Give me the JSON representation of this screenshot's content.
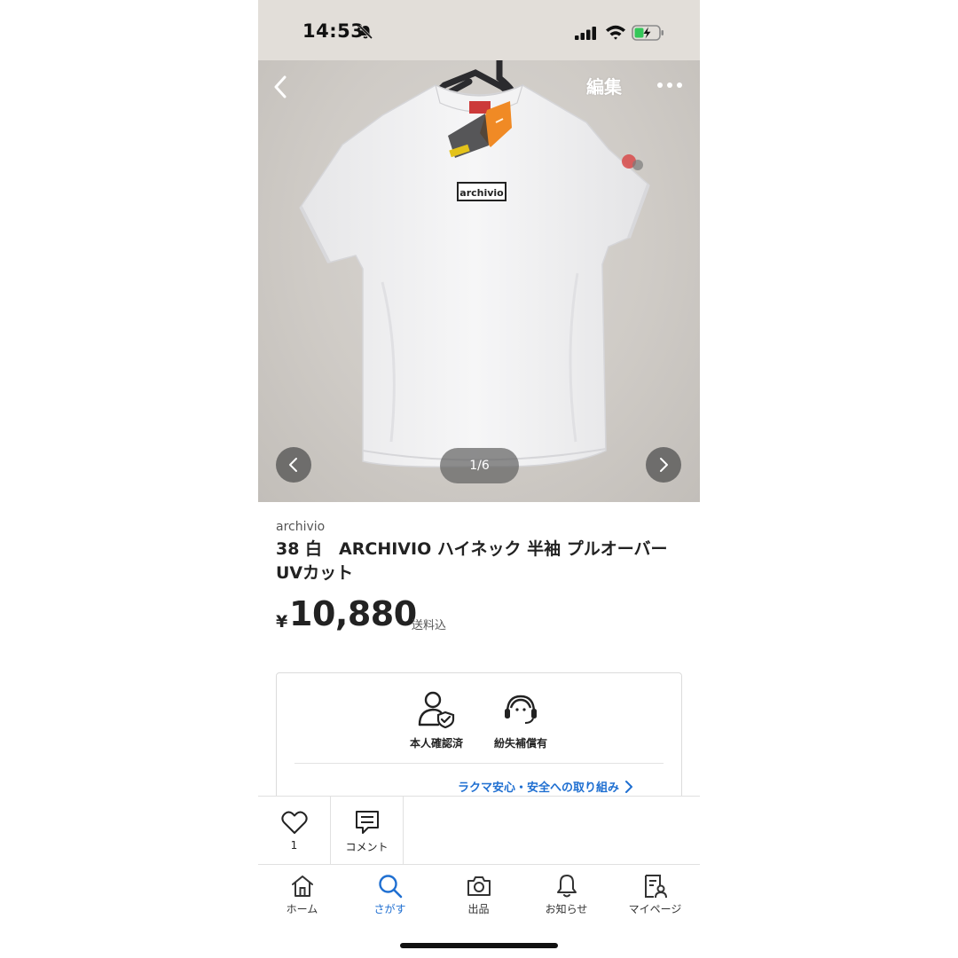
{
  "status_bar": {
    "time": "14:53",
    "icons": [
      "bell-off-icon",
      "signal-icon",
      "wifi-icon",
      "battery-charging-icon"
    ]
  },
  "header": {
    "back_icon": "chevron-left-icon",
    "edit_label": "編集",
    "more_icon": "more-dots-icon"
  },
  "gallery": {
    "current": 1,
    "total": 6,
    "counter_text": "1/6",
    "photo_print_text": "archivio"
  },
  "product": {
    "brand": "archivio",
    "title": "38 白　ARCHIVIO ハイネック 半袖 プルオーバー UVカット",
    "currency_symbol": "¥",
    "price": "10,880",
    "shipping_note": "送料込"
  },
  "trust": {
    "items": [
      {
        "icon": "identity-verified-icon",
        "label": "本人確認済"
      },
      {
        "icon": "support-headset-icon",
        "label": "紛失補償有"
      }
    ],
    "link_label": "ラクマ安心・安全への取り組み"
  },
  "actions": {
    "like": {
      "icon": "heart-icon",
      "count": "1"
    },
    "comment": {
      "icon": "comment-icon",
      "label": "コメント"
    }
  },
  "tabs": [
    {
      "icon": "home-icon",
      "label": "ホーム",
      "active": false
    },
    {
      "icon": "search-icon",
      "label": "さがす",
      "active": true
    },
    {
      "icon": "camera-icon",
      "label": "出品",
      "active": false
    },
    {
      "icon": "bell-icon",
      "label": "お知らせ",
      "active": false
    },
    {
      "icon": "my-page-icon",
      "label": "マイページ",
      "active": false
    }
  ],
  "colors": {
    "accent": "#1f6fd1",
    "status_bar_bg": "#e2ded9"
  }
}
